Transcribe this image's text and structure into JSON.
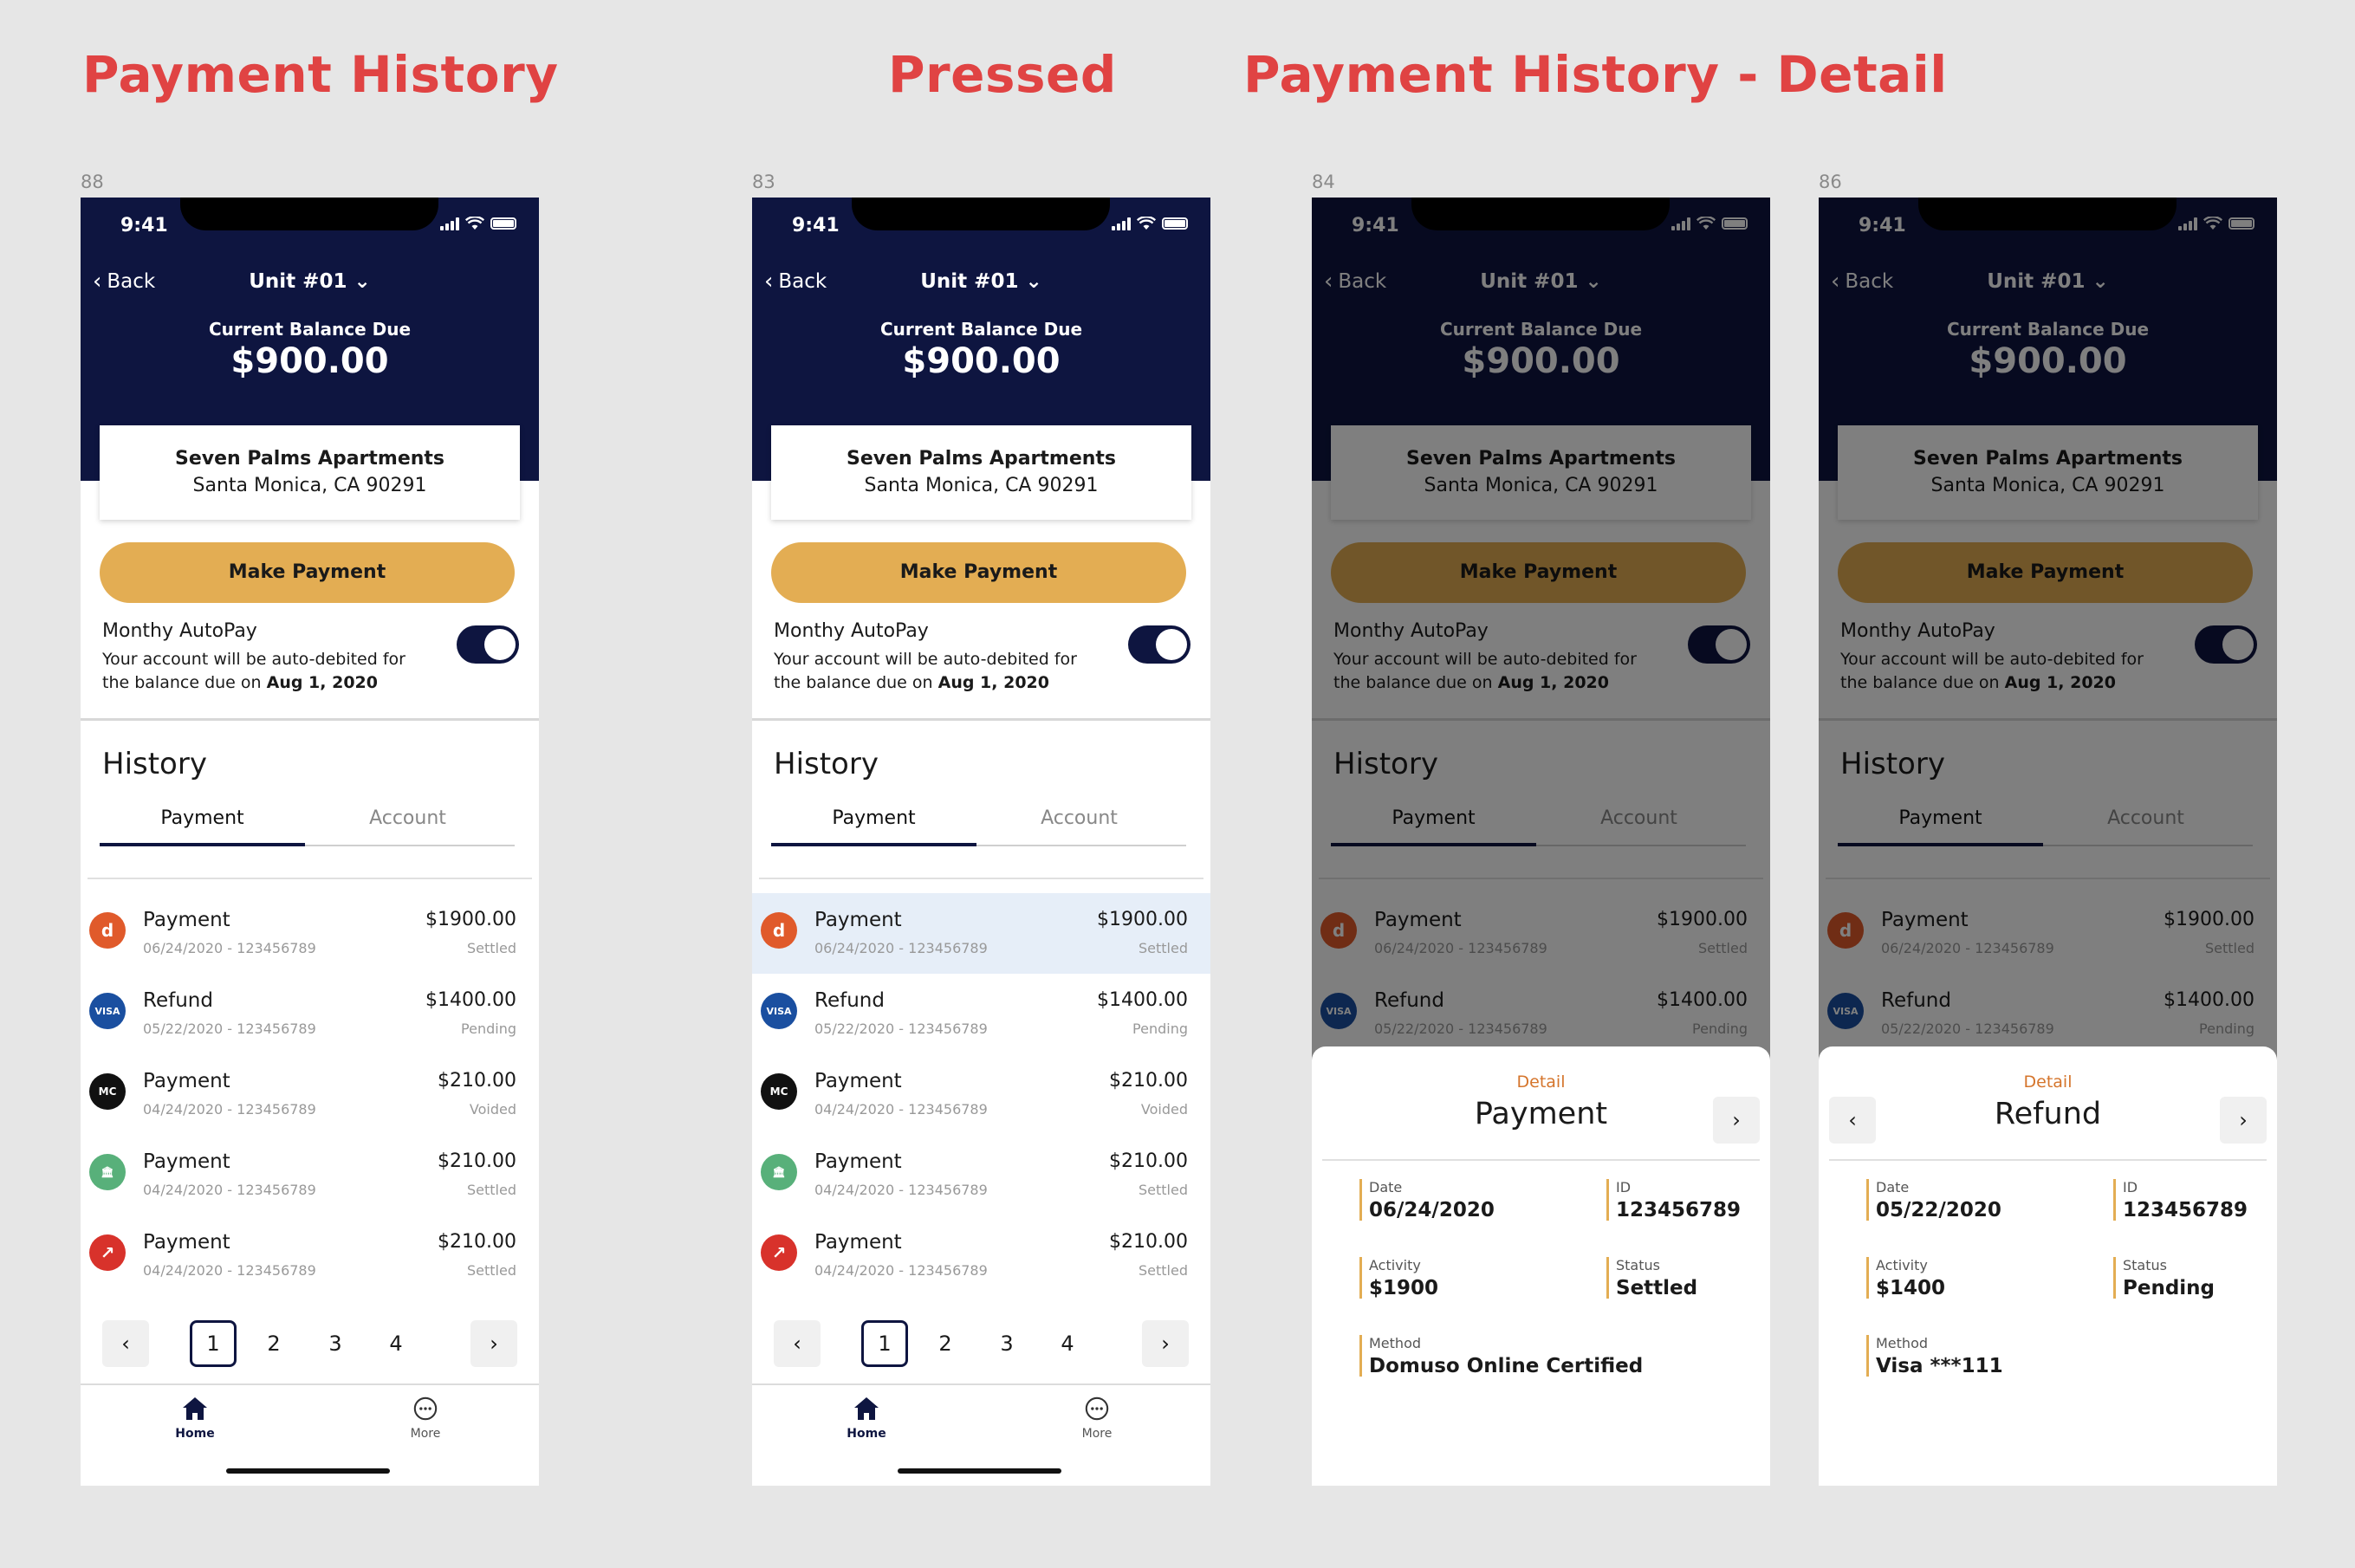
{
  "section_titles": [
    "Payment History",
    "Pressed",
    "Payment History - Detail"
  ],
  "frames": [
    {
      "label": "88",
      "variant": "normal"
    },
    {
      "label": "83",
      "variant": "pressed"
    },
    {
      "label": "84",
      "variant": "detail",
      "detail_key": "payment"
    },
    {
      "label": "86",
      "variant": "detail",
      "detail_key": "refund"
    }
  ],
  "app": {
    "status_time": "9:41",
    "back_label": "Back",
    "unit_label": "Unit #01",
    "balance_label": "Current Balance Due",
    "balance_amount": "$900.00",
    "property_name": "Seven Palms Apartments",
    "property_address": "Santa Monica, CA 90291",
    "make_payment_label": "Make Payment",
    "autopay_title": "Monthy AutoPay",
    "autopay_desc": "Your account will be auto-debited for the balance due on",
    "autopay_date": "Aug 1, 2020",
    "autopay_on": true,
    "history_title": "History",
    "tabs": [
      "Payment",
      "Account"
    ],
    "transactions": [
      {
        "type": "Payment",
        "sub": "06/24/2020 - 123456789",
        "amount": "$1900.00",
        "status": "Settled",
        "icon": "badge-icon",
        "color": "#e05a2b",
        "glyph": "d"
      },
      {
        "type": "Refund",
        "sub": "05/22/2020 - 123456789",
        "amount": "$1400.00",
        "status": "Pending",
        "icon": "visa-icon",
        "color": "#1a4fa0",
        "glyph": "VISA"
      },
      {
        "type": "Payment",
        "sub": "04/24/2020 - 123456789",
        "amount": "$210.00",
        "status": "Voided",
        "icon": "mastercard-icon",
        "color": "#111111",
        "glyph": "MC"
      },
      {
        "type": "Payment",
        "sub": "04/24/2020 - 123456789",
        "amount": "$210.00",
        "status": "Settled",
        "icon": "bank-icon",
        "color": "#58b07a",
        "glyph": "🏛"
      },
      {
        "type": "Payment",
        "sub": "04/24/2020 - 123456789",
        "amount": "$210.00",
        "status": "Settled",
        "icon": "arrow-brand-icon",
        "color": "#d8322b",
        "glyph": "↗"
      }
    ],
    "pages": [
      "1",
      "2",
      "3",
      "4"
    ],
    "current_page": "1",
    "nav": [
      {
        "label": "Home",
        "icon": "home-icon"
      },
      {
        "label": "More",
        "icon": "more-icon"
      }
    ]
  },
  "details": {
    "payment": {
      "label": "Detail",
      "title": "Payment",
      "date_label": "Date",
      "date": "06/24/2020",
      "id_label": "ID",
      "id": "123456789",
      "activity_label": "Activity",
      "activity": "$1900",
      "status_label": "Status",
      "status": "Settled",
      "method_label": "Method",
      "method": "Domuso Online Certified",
      "has_prev": false,
      "has_next": true
    },
    "refund": {
      "label": "Detail",
      "title": "Refund",
      "date_label": "Date",
      "date": "05/22/2020",
      "id_label": "ID",
      "id": "123456789",
      "activity_label": "Activity",
      "activity": "$1400",
      "status_label": "Status",
      "status": "Pending",
      "method_label": "Method",
      "method": "Visa ***111",
      "has_prev": true,
      "has_next": true
    }
  },
  "colors": {
    "header_bg": "#0e1540",
    "accent_gold": "#e3ad53",
    "title_red": "#e04343",
    "detail_orange": "#d5752c",
    "pressed_bg": "#e6eef8"
  }
}
